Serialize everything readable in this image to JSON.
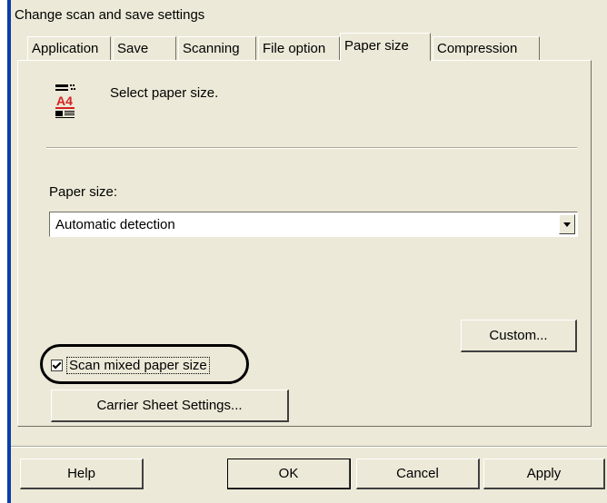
{
  "dialog": {
    "title": "Change scan and save settings"
  },
  "tabs": [
    {
      "label": "Application",
      "active": false
    },
    {
      "label": "Save",
      "active": false
    },
    {
      "label": "Scanning",
      "active": false
    },
    {
      "label": "File option",
      "active": false
    },
    {
      "label": "Paper size",
      "active": true
    },
    {
      "label": "Compression",
      "active": false
    }
  ],
  "panel": {
    "header_icon": "a4-paper-icon",
    "header_text": "Select paper size.",
    "paper_size_label": "Paper size:",
    "paper_size_value": "Automatic detection",
    "custom_button": "Custom...",
    "scan_mixed_label": "Scan mixed paper size",
    "scan_mixed_checked": true,
    "carrier_sheet_button": "Carrier Sheet Settings..."
  },
  "footer": {
    "help": "Help",
    "ok": "OK",
    "cancel": "Cancel",
    "apply": "Apply"
  },
  "colors": {
    "dialog_bg": "#ece9d8",
    "accent_edge": "#0a3ea6",
    "icon_red": "#d42020"
  }
}
